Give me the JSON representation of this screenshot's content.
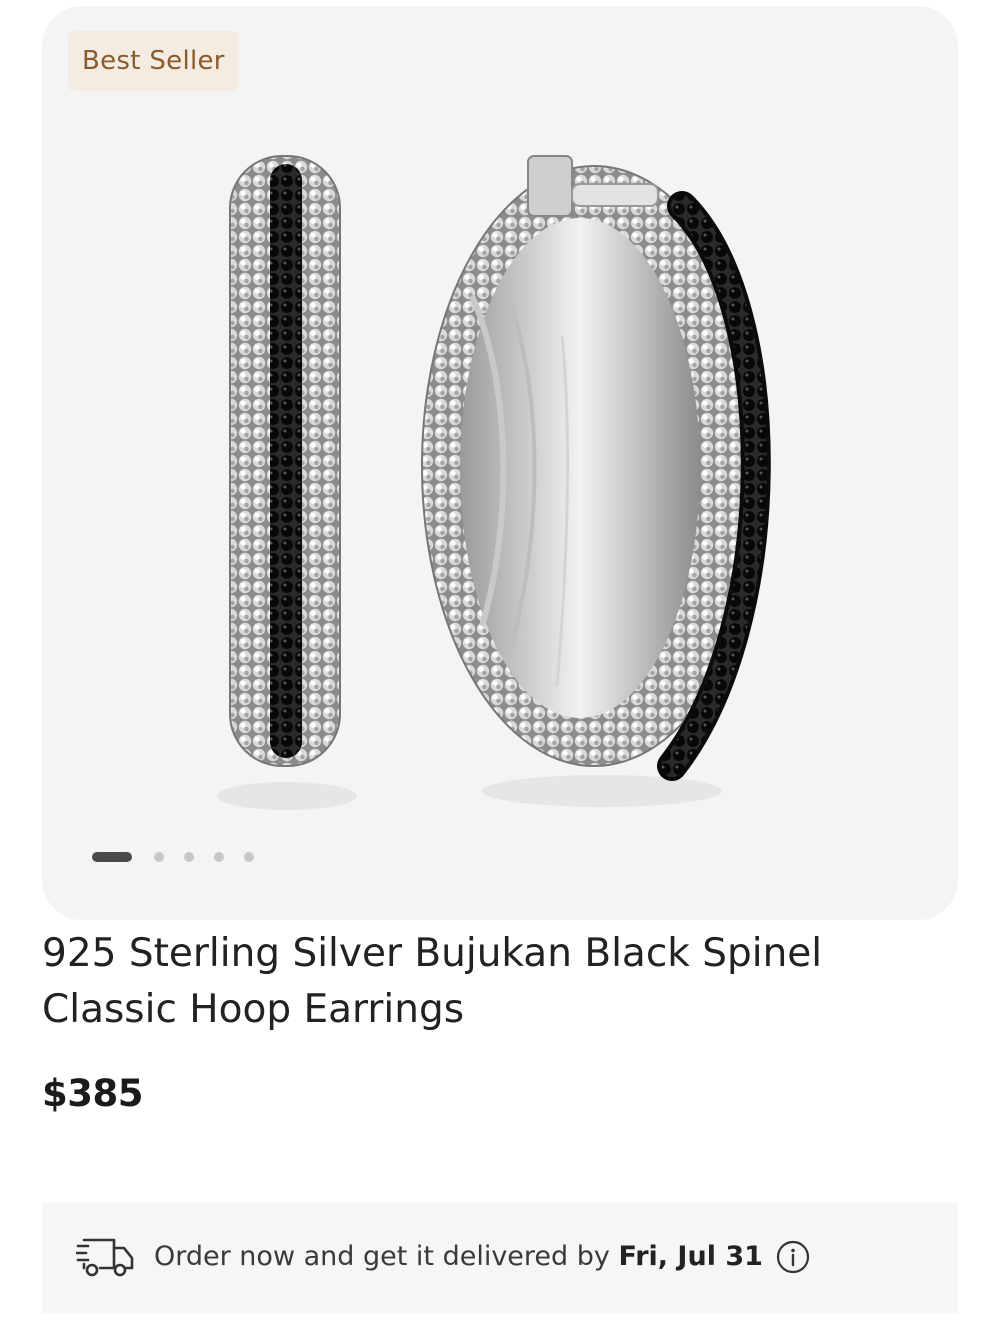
{
  "product": {
    "badge": "Best Seller",
    "title": "925 Sterling Silver Bujukan Black Spinel Classic Hoop Earrings",
    "price": "$385",
    "image_alt": "product-photo-hoop-earrings",
    "carousel": {
      "total": 5,
      "active": 1
    }
  },
  "delivery": {
    "prefix": "Order now and get it delivered by",
    "date": "Fri, Jul 31",
    "truck_icon": "delivery-truck-icon",
    "info_icon": "info-icon"
  },
  "colors": {
    "badge_bg": "#f4ece2",
    "badge_text": "#8a5b2c",
    "gallery_bg": "#f4f4f4",
    "delivery_bg": "#f6f6f6"
  }
}
